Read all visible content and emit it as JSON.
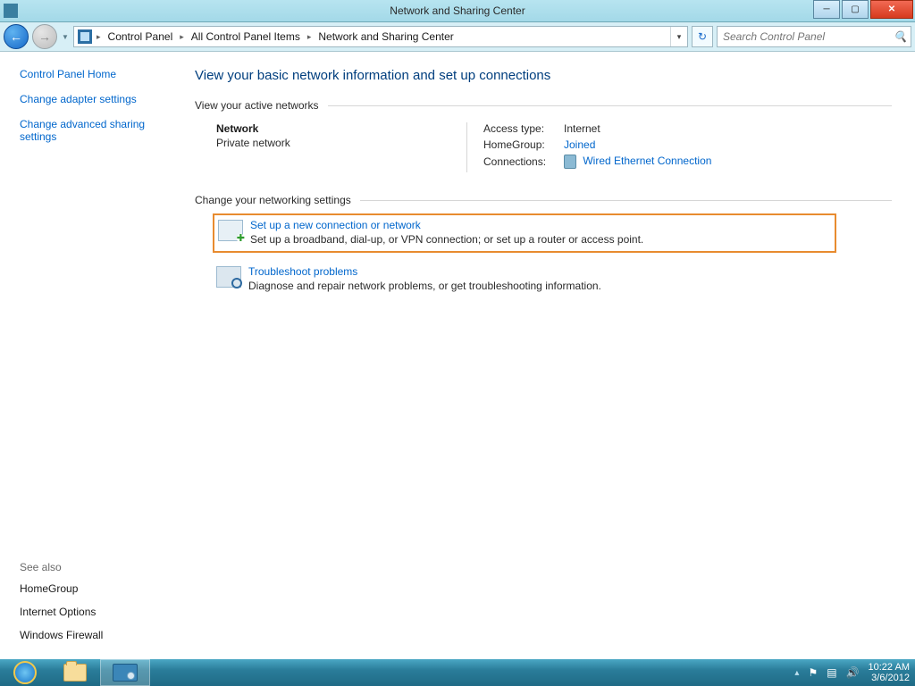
{
  "window": {
    "title": "Network and Sharing Center"
  },
  "breadcrumb": {
    "root": "Control Panel",
    "mid": "All Control Panel Items",
    "leaf": "Network and Sharing Center",
    "sep": "▸"
  },
  "search": {
    "placeholder": "Search Control Panel"
  },
  "sidebar": {
    "home": "Control Panel Home",
    "adapter": "Change adapter settings",
    "advanced": "Change advanced sharing settings",
    "see_also": "See also",
    "homegroup": "HomeGroup",
    "ioptions": "Internet Options",
    "firewall": "Windows Firewall"
  },
  "main": {
    "title": "View your basic network information and set up connections",
    "section_active": "View your active networks",
    "network": {
      "name": "Network",
      "type": "Private network",
      "access_label": "Access type:",
      "access_value": "Internet",
      "homegroup_label": "HomeGroup:",
      "homegroup_value": "Joined",
      "conn_label": "Connections:",
      "conn_value": "Wired Ethernet Connection"
    },
    "section_change": "Change your networking settings",
    "tasks": {
      "setup_title": "Set up a new connection or network",
      "setup_desc": "Set up a broadband, dial-up, or VPN connection; or set up a router or access point.",
      "trouble_title": "Troubleshoot problems",
      "trouble_desc": "Diagnose and repair network problems, or get troubleshooting information."
    }
  },
  "taskbar": {
    "show_hidden": "▴",
    "time": "10:22 AM",
    "date": "3/6/2012"
  }
}
